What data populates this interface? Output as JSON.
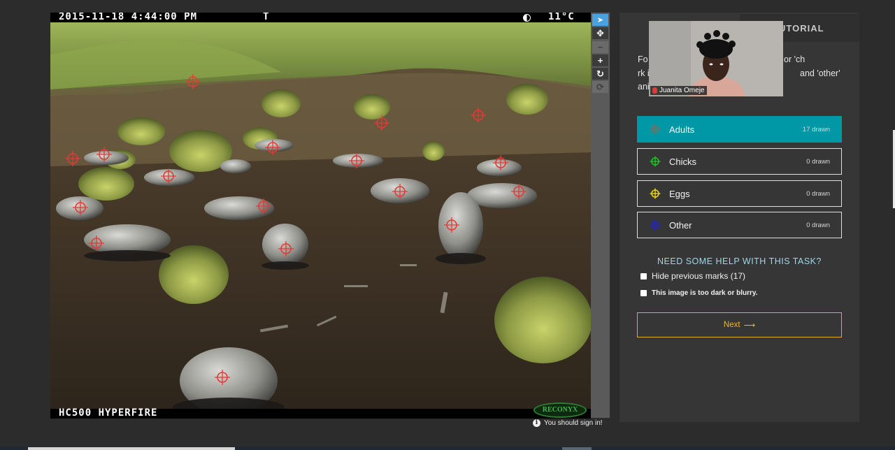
{
  "camera": {
    "datetime": "2015-11-18 4:44:00 PM",
    "mode": "T",
    "temperature": "11°C",
    "model": "HC500 HYPERFIRE",
    "brand": "RECONYX"
  },
  "toolbar": {
    "tools": [
      {
        "name": "pointer-tool",
        "glyph": "➤",
        "state": "active"
      },
      {
        "name": "pan-tool",
        "glyph": "✥",
        "state": "normal"
      },
      {
        "name": "zoom-out-tool",
        "glyph": "−",
        "state": "disabled"
      },
      {
        "name": "zoom-in-tool",
        "glyph": "+",
        "state": "normal"
      },
      {
        "name": "rotate-tool",
        "glyph": "↻",
        "state": "normal"
      },
      {
        "name": "reset-tool",
        "glyph": "⟳",
        "state": "disabled"
      }
    ]
  },
  "signin_note": "You should sign in!",
  "panel": {
    "tutorial_tab": "UTORIAL",
    "instructions": "Fo                                          ct 'adult' or 'ch                                           rk its centre. Ple                                         and 'other' animals.",
    "tools": [
      {
        "label": "Adults",
        "count": "17 drawn",
        "color": "#e53935",
        "selected": true
      },
      {
        "label": "Chicks",
        "count": "0 drawn",
        "color": "#22c122",
        "selected": false
      },
      {
        "label": "Eggs",
        "count": "0 drawn",
        "color": "#e6d21f",
        "selected": false
      },
      {
        "label": "Other",
        "count": "0 drawn",
        "color": "#2323c8",
        "selected": false
      }
    ],
    "help_link": "NEED SOME HELP WITH THIS TASK?",
    "hide_marks_label": "Hide previous marks (17)",
    "too_dark_label": "This image is too dark or blurry.",
    "next_label": "Next",
    "next_arrow": "⟶"
  },
  "video": {
    "participant_name": "Juanita Omeje"
  },
  "accent_color": "#0097a7"
}
